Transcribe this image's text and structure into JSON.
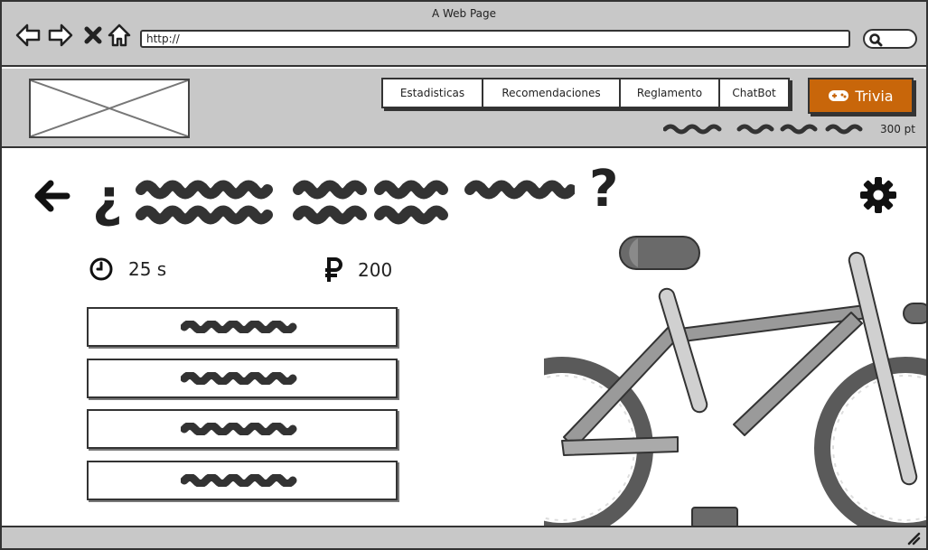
{
  "window": {
    "title": "A Web Page"
  },
  "browser": {
    "url": "http://"
  },
  "nav": {
    "tabs": [
      {
        "label": "Estadisticas"
      },
      {
        "label": "Recomendaciones"
      },
      {
        "label": "Reglamento"
      },
      {
        "label": "ChatBot"
      }
    ],
    "trivia_label": "Trivia"
  },
  "user": {
    "points": "300 pt"
  },
  "question": {
    "open_mark": "¿",
    "close_mark": "?"
  },
  "stats": {
    "time": "25 s",
    "reward": "200"
  },
  "icons": {
    "back": "back-arrow-icon",
    "forward": "forward-arrow-icon",
    "stop": "close-icon",
    "home": "home-icon",
    "search": "search-icon",
    "settings": "gear-icon",
    "timer": "clock-icon",
    "currency": "ruble-icon",
    "gamepad": "gamepad-icon"
  },
  "colors": {
    "chrome": "#c8c8c8",
    "accent": "#c8660a",
    "ink": "#222222"
  }
}
